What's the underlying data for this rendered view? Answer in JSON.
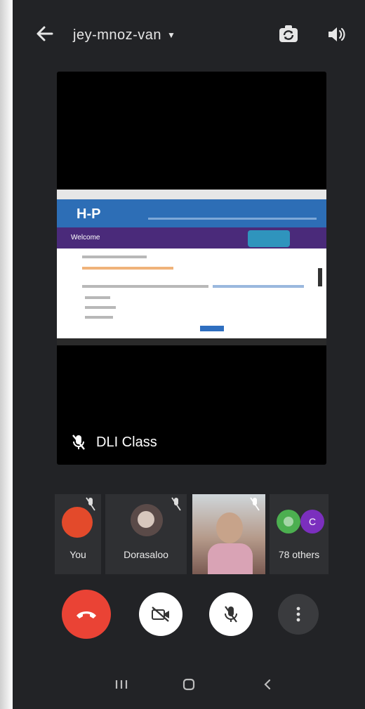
{
  "header": {
    "title": "jey-mnoz-van"
  },
  "stage": {
    "presenter_label": "DLI Class",
    "shared_screen": {
      "logo": "H-P",
      "banner": "Welcome"
    }
  },
  "participants": [
    {
      "name": "You",
      "avatar_color": "#e34a2b"
    },
    {
      "name": "Dorasaloo",
      "avatar_color": "#5a4a48"
    },
    {
      "name": "",
      "avatar_color": "#c7a38a"
    },
    {
      "name": "78 others",
      "avatar_colors": [
        "#4caf50",
        "#7b2fbe"
      ],
      "avatar_initial": "C"
    }
  ],
  "colors": {
    "end_call": "#ea4335",
    "control_white": "#ffffff",
    "more_bg": "#3a3b3e",
    "background": "#222326"
  },
  "icons": {
    "back": "arrow-left",
    "flip": "switch-camera",
    "speaker": "volume",
    "end_call": "phone-hangup",
    "camera_off": "video-off",
    "mic_off": "mic-off",
    "more": "more-vertical"
  }
}
